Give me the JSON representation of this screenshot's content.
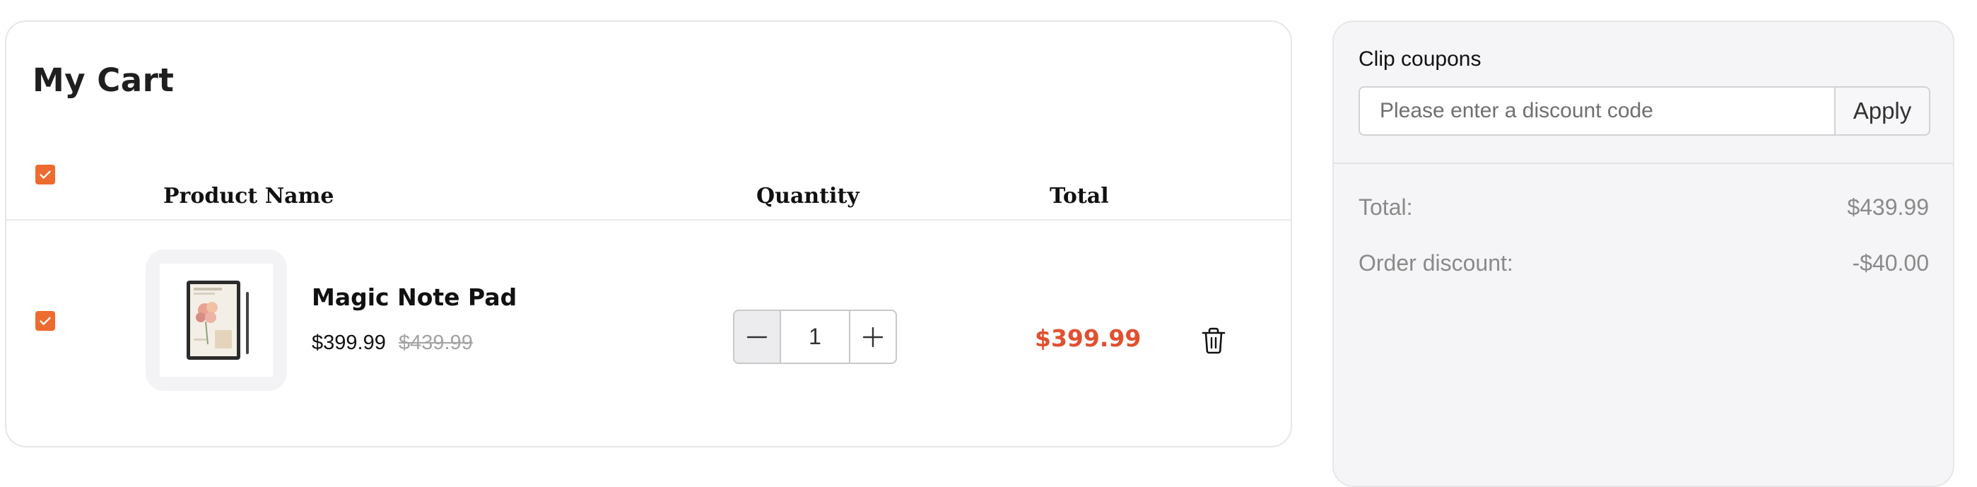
{
  "cart": {
    "title": "My Cart",
    "columns": {
      "product_name": "Product Name",
      "quantity": "Quantity",
      "total": "Total"
    },
    "select_all_checked": true,
    "items": [
      {
        "checked": true,
        "name": "Magic Note Pad",
        "price": "$399.99",
        "original_price": "$439.99",
        "quantity": "1",
        "line_total": "$399.99",
        "thumbnail_icon": "tablet-with-stylus"
      }
    ]
  },
  "coupons": {
    "label": "Clip coupons",
    "input_placeholder": "Please enter a discount code",
    "input_value": "",
    "apply_label": "Apply"
  },
  "summary": {
    "total_label": "Total:",
    "total_value": "$439.99",
    "discount_label": "Order discount:",
    "discount_value": "-$40.00"
  },
  "colors": {
    "accent": "#ee6b2f",
    "price_highlight": "#e1502f",
    "panel_border": "#e7e7e9",
    "summary_bg": "#f5f5f7"
  }
}
